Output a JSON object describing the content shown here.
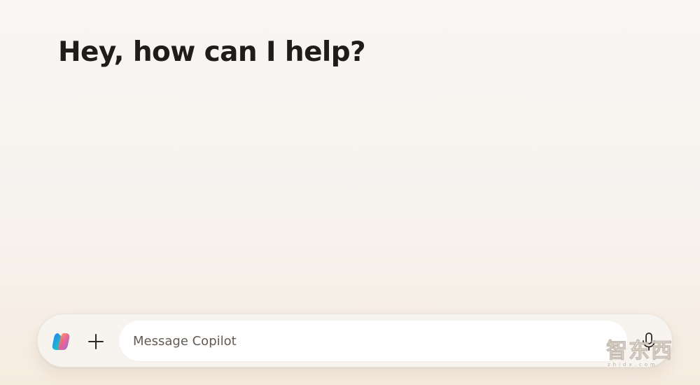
{
  "header": {
    "greeting": "Hey, how can I help?"
  },
  "composer": {
    "placeholder": "Message Copilot",
    "value": "",
    "copilot_icon": "copilot-logo-icon",
    "add_icon": "plus-icon",
    "mic_icon": "microphone-icon"
  },
  "watermark": {
    "text": "智东西"
  },
  "colors": {
    "background_top": "#f8f5f2",
    "background_bottom": "#f6ebdf",
    "heading_text": "#1f1c1a",
    "placeholder_text": "#625a53",
    "input_background": "#ffffff"
  }
}
